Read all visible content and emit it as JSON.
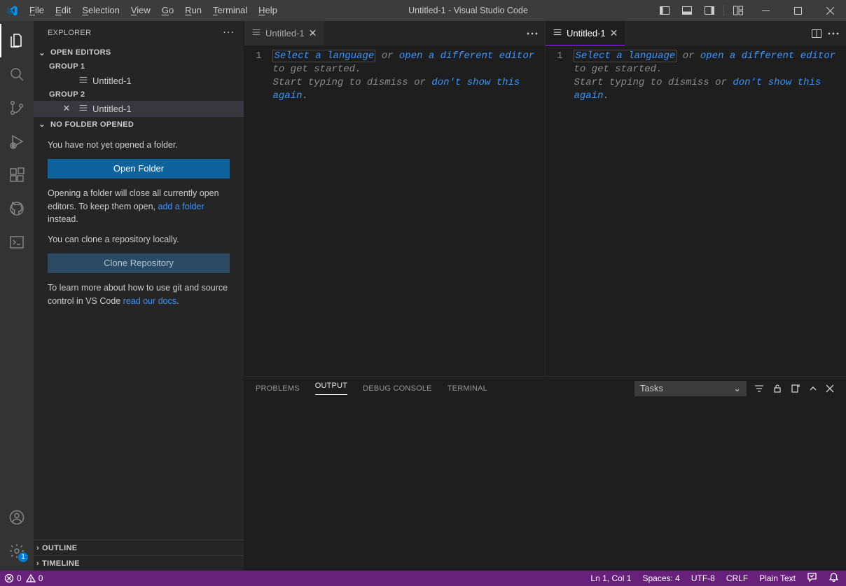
{
  "title": "Untitled-1 - Visual Studio Code",
  "menu": {
    "file": "File",
    "edit": "Edit",
    "selection": "Selection",
    "view": "View",
    "go": "Go",
    "run": "Run",
    "terminal": "Terminal",
    "help": "Help"
  },
  "sidebar": {
    "title": "EXPLORER",
    "openEditors": "OPEN EDITORS",
    "group1": "GROUP 1",
    "group2": "GROUP 2",
    "file1": "Untitled-1",
    "file2": "Untitled-1",
    "noFolder": "NO FOLDER OPENED",
    "noFolderMsg": "You have not yet opened a folder.",
    "openFolderBtn": "Open Folder",
    "openHint1": "Opening a folder will close all currently open editors. To keep them open, ",
    "addFolderLink": "add a folder",
    "openHint2": " instead.",
    "cloneMsg": "You can clone a repository locally.",
    "cloneBtn": "Clone Repository",
    "gitMsg1": "To learn more about how to use git and source control in VS Code ",
    "readDocs": "read our docs",
    "outline": "OUTLINE",
    "timeline": "TIMELINE"
  },
  "editor": {
    "tab1": "Untitled-1",
    "tab2": "Untitled-1",
    "lineNo": "1",
    "selectLang": "Select a language",
    "or": " or ",
    "openDiff": "open a different editor",
    "getStarted": " to get started.",
    "startTyping": "Start typing to dismiss or ",
    "dontShow": "don't show this again",
    "period": "."
  },
  "panel": {
    "problems": "PROBLEMS",
    "output": "OUTPUT",
    "debug": "DEBUG CONSOLE",
    "terminal": "TERMINAL",
    "tasks": "Tasks"
  },
  "status": {
    "err": "0",
    "warn": "0",
    "ln": "Ln 1, Col 1",
    "spaces": "Spaces: 4",
    "enc": "UTF-8",
    "eol": "CRLF",
    "lang": "Plain Text"
  },
  "settingsBadge": "1"
}
